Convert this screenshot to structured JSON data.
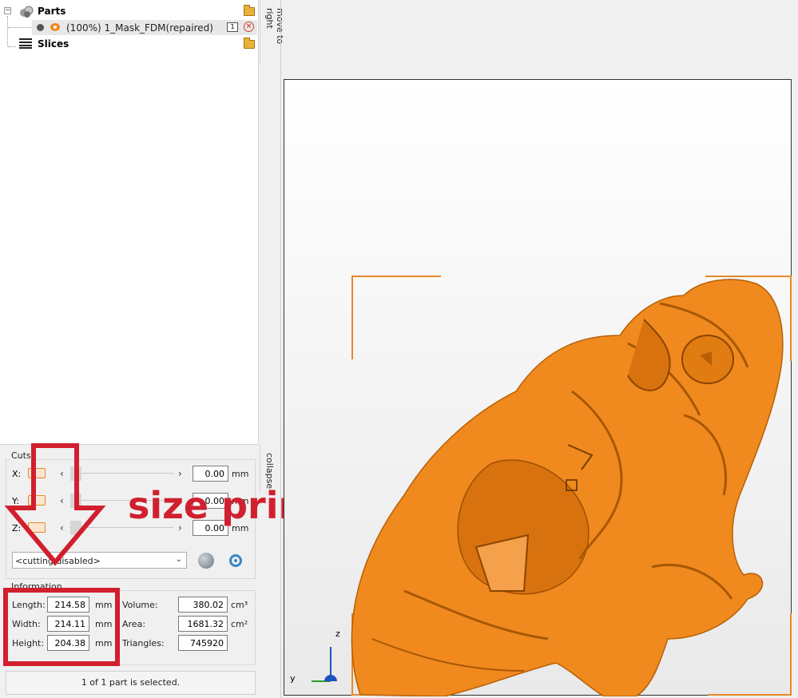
{
  "tree": {
    "parts_label": "Parts",
    "part_item": "(100%) 1_Mask_FDM(repaired)",
    "part_count": "1",
    "slices_label": "Slices",
    "expander": "−"
  },
  "side_tabs": {
    "move": "move to right",
    "collapse": "collapse"
  },
  "cuts": {
    "title": "Cuts",
    "axes": [
      {
        "label": "X:",
        "value": "0.00",
        "unit": "mm"
      },
      {
        "label": "Y:",
        "value": "0.00",
        "unit": "mm"
      },
      {
        "label": "Z:",
        "value": "0.00",
        "unit": "mm"
      }
    ],
    "mode": "<cutting disabled>"
  },
  "info": {
    "title": "Information",
    "length_label": "Length:",
    "length": "214.58",
    "length_unit": "mm",
    "width_label": "Width:",
    "width": "214.11",
    "width_unit": "mm",
    "height_label": "Height:",
    "height": "204.38",
    "height_unit": "mm",
    "volume_label": "Volume:",
    "volume": "380.02",
    "volume_unit": "cm³",
    "area_label": "Area:",
    "area": "1681.32",
    "area_unit": "cm²",
    "triangles_label": "Triangles:",
    "triangles": "745920"
  },
  "status": "1 of 1 part is selected.",
  "annotation": {
    "text": "size print"
  },
  "viewport": {
    "axis_z": "z",
    "axis_y": "y"
  },
  "colors": {
    "accent": "#e8882a",
    "model": "#f08a1e",
    "annotation": "#d21f2e"
  }
}
